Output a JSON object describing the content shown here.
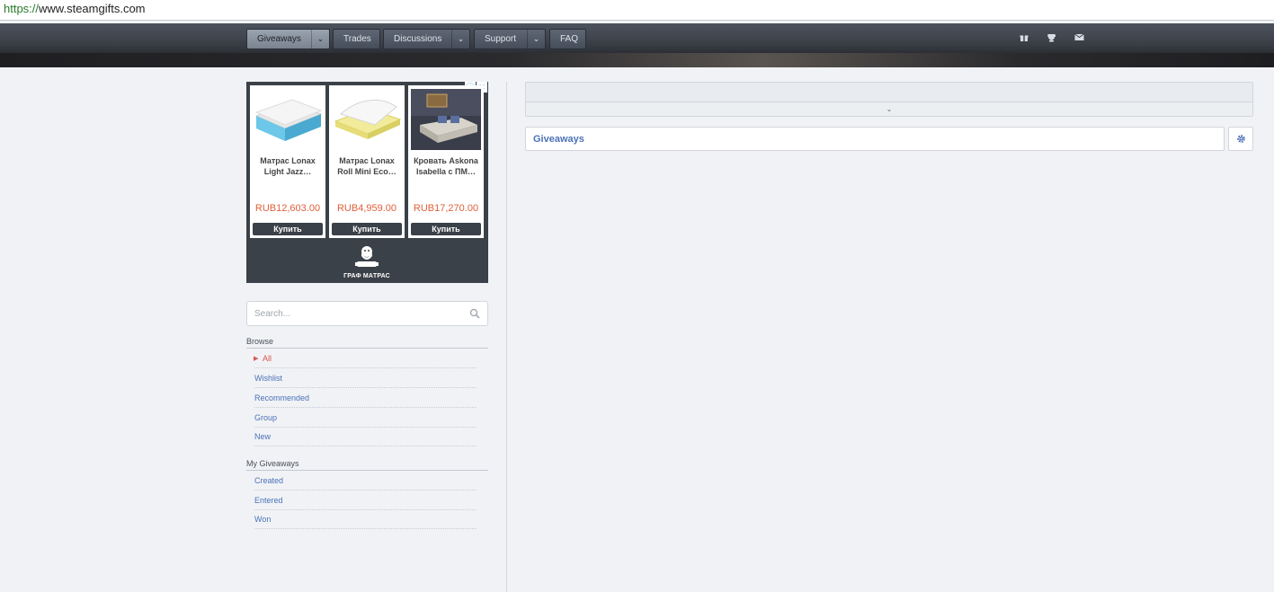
{
  "browser": {
    "url_protocol": "https://",
    "url_rest": "www.steamgifts.com"
  },
  "nav": {
    "giveaways": "Giveaways",
    "trades": "Trades",
    "discussions": "Discussions",
    "support": "Support",
    "faq": "FAQ",
    "icons": [
      "gift-icon",
      "trophy-icon",
      "envelope-icon"
    ]
  },
  "ad": {
    "products": [
      {
        "title": "Матрас Lonax Light Jazz…",
        "price": "RUB12,603.00",
        "buy": "Купить"
      },
      {
        "title": "Матрас Lonax Roll Mini Eco…",
        "price": "RUB4,959.00",
        "buy": "Купить"
      },
      {
        "title": "Кровать Askona Isabella с ПМ…",
        "price": "RUB17,270.00",
        "buy": "Купить"
      }
    ],
    "brand": "ГРАФ МАТРАС"
  },
  "search": {
    "placeholder": "Search..."
  },
  "sidebar": {
    "browse_heading": "Browse",
    "browse_items": [
      "All",
      "Wishlist",
      "Recommended",
      "Group",
      "New"
    ],
    "active_item": "All",
    "my_heading": "My Giveaways",
    "my_items": [
      "Created",
      "Entered",
      "Won"
    ]
  },
  "main": {
    "heading": "Giveaways"
  },
  "colors": {
    "link": "#4b72b8",
    "active": "#d9534f",
    "price": "#e0603a"
  }
}
